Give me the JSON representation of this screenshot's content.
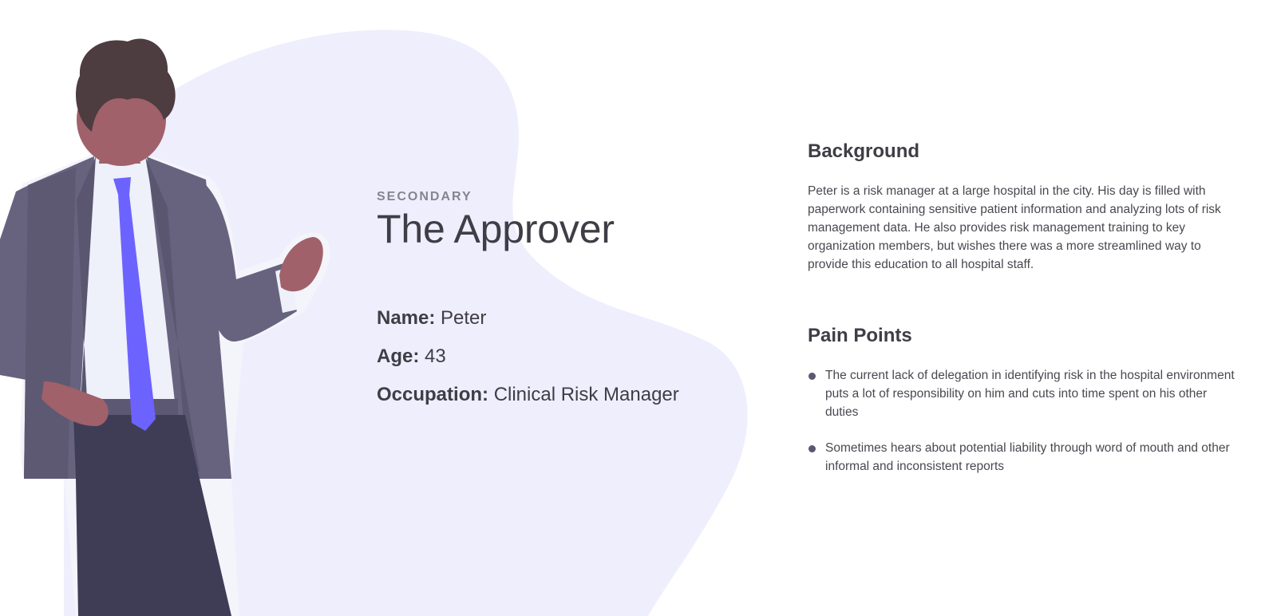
{
  "persona": {
    "tier": "SECONDARY",
    "title": "The Approver",
    "fields": {
      "name": {
        "label": "Name:",
        "value": "Peter"
      },
      "age": {
        "label": "Age:",
        "value": "43"
      },
      "occupation": {
        "label": "Occupation:",
        "value": "Clinical Risk Manager"
      }
    }
  },
  "background": {
    "heading": "Background",
    "text": "Peter is a risk manager at a large hospital in the city. His day is filled with paperwork containing sensitive patient information and analyzing lots of risk management data. He also provides risk management training to key organization members, but wishes there was a more streamlined way to provide this education to all hospital staff."
  },
  "pain_points": {
    "heading": "Pain Points",
    "items": [
      "The current lack of delegation in identifying risk in the hospital environment puts a lot of responsibility on him and cuts into time spent on his other duties",
      "Sometimes hears about potential liability through word of mouth and other informal and inconsistent reports"
    ]
  },
  "colors": {
    "blob": "#efeefd",
    "suit": "#67637f",
    "pants": "#3f3d56",
    "tie": "#6c63ff",
    "skin": "#a0616a",
    "hair": "#4d3c40",
    "shirt": "#eef0fa",
    "text": "#3f3d45"
  },
  "illustration": {
    "name": "businessman-person-illustration"
  }
}
